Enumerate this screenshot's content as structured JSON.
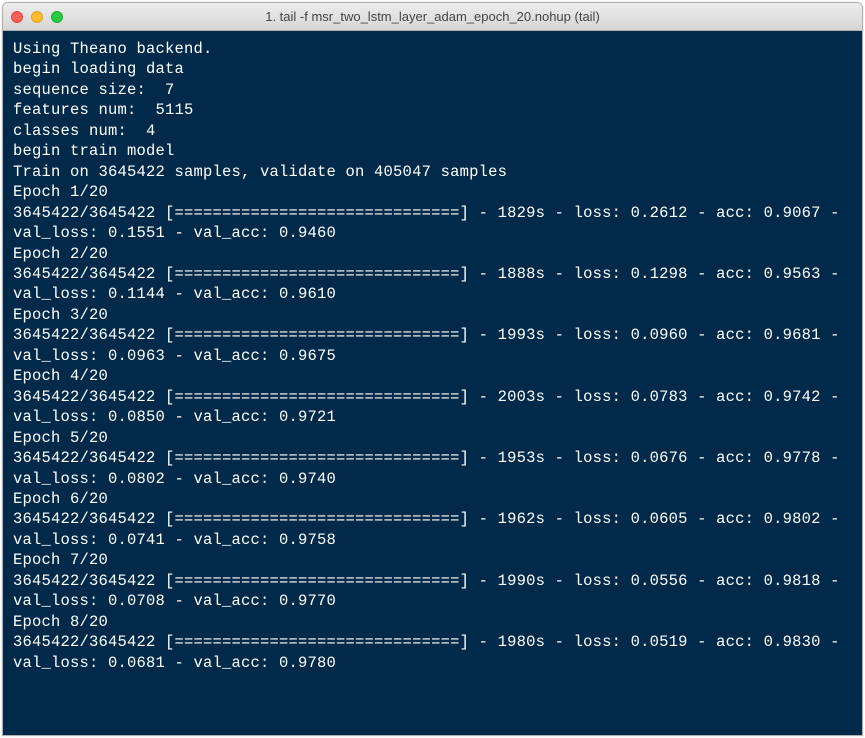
{
  "window": {
    "title": "1. tail -f msr_two_lstm_layer_adam_epoch_20.nohup (tail)"
  },
  "header_lines": [
    "Using Theano backend.",
    "begin loading data",
    "sequence size:  7",
    "features num:  5115",
    "classes num:  4",
    "begin train model",
    "Train on 3645422 samples, validate on 405047 samples"
  ],
  "progress": {
    "current": 3645422,
    "total": 3645422,
    "bar": "[==============================]"
  },
  "total_epochs": 20,
  "epochs": [
    {
      "n": 1,
      "time": 1829,
      "loss": "0.2612",
      "acc": "0.9067",
      "val_loss": "0.1551",
      "val_acc": "0.9460"
    },
    {
      "n": 2,
      "time": 1888,
      "loss": "0.1298",
      "acc": "0.9563",
      "val_loss": "0.1144",
      "val_acc": "0.9610"
    },
    {
      "n": 3,
      "time": 1993,
      "loss": "0.0960",
      "acc": "0.9681",
      "val_loss": "0.0963",
      "val_acc": "0.9675"
    },
    {
      "n": 4,
      "time": 2003,
      "loss": "0.0783",
      "acc": "0.9742",
      "val_loss": "0.0850",
      "val_acc": "0.9721"
    },
    {
      "n": 5,
      "time": 1953,
      "loss": "0.0676",
      "acc": "0.9778",
      "val_loss": "0.0802",
      "val_acc": "0.9740"
    },
    {
      "n": 6,
      "time": 1962,
      "loss": "0.0605",
      "acc": "0.9802",
      "val_loss": "0.0741",
      "val_acc": "0.9758"
    },
    {
      "n": 7,
      "time": 1990,
      "loss": "0.0556",
      "acc": "0.9818",
      "val_loss": "0.0708",
      "val_acc": "0.9770"
    },
    {
      "n": 8,
      "time": 1980,
      "loss": "0.0519",
      "acc": "0.9830",
      "val_loss": "0.0681",
      "val_acc": "0.9780"
    }
  ]
}
